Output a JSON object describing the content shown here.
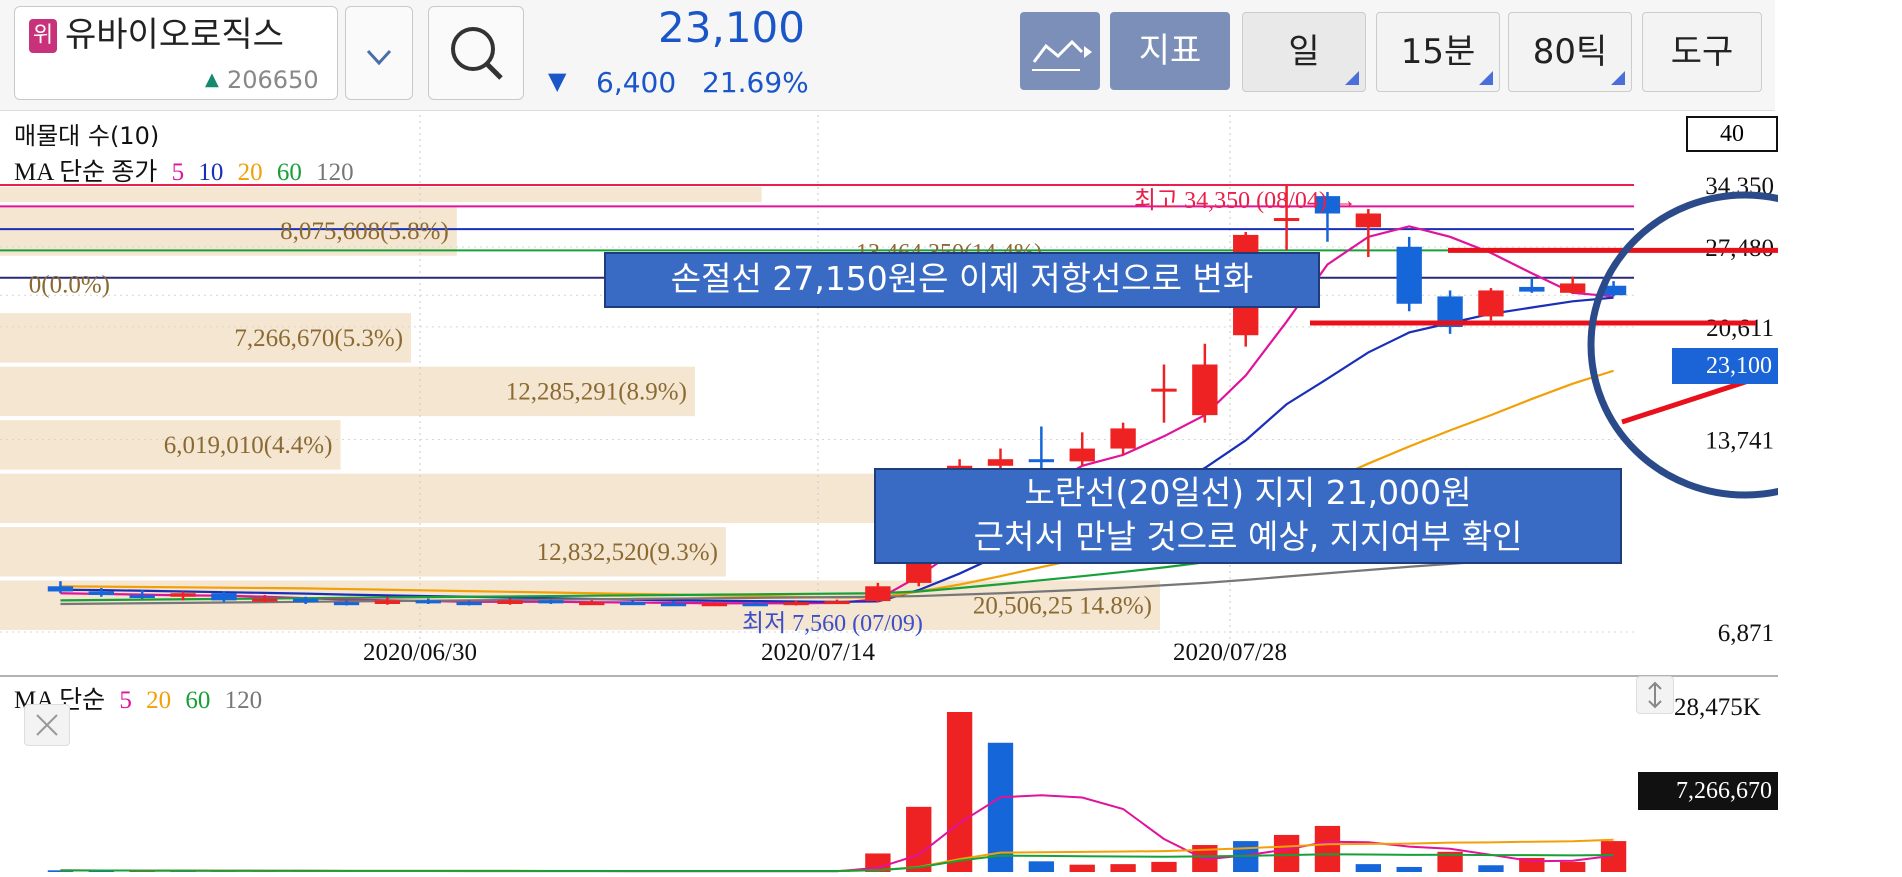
{
  "header": {
    "stock_icon_char": "위",
    "stock_name": "유바이오로직스",
    "stock_code": "206650",
    "price": "23,100",
    "change_arrow": "▼",
    "change": "6,400",
    "change_pct": "21.69%",
    "buttons": {
      "indicator": "지표",
      "period_day": "일",
      "period_15min": "15분",
      "period_80tick": "80틱",
      "tools": "도구"
    },
    "colors": {
      "down": "#1a56c8",
      "toggle_bg": "#7b8fb8"
    }
  },
  "price_panel": {
    "volume_profile_label": "매물대 수(10)",
    "ma_label": "MA 단순 종가",
    "ma_periods": [
      {
        "label": "5",
        "color": "#e0139a"
      },
      {
        "label": "10",
        "color": "#1a2fb8"
      },
      {
        "label": "20",
        "color": "#f2a007"
      },
      {
        "label": "60",
        "color": "#18a038"
      },
      {
        "label": "120",
        "color": "#777777"
      }
    ],
    "bins_box_value": "40",
    "high_annotation": "최고 34,350 (08/04) →",
    "low_annotation": "최저 7,560 (07/09)",
    "partial_label": "13,464,350(14.4%)",
    "volume_profile_labels": [
      "8,075,608(5.8%)",
      "0(0.0%)",
      "7,266,670(5.3%)",
      "12,285,291(8.9%)",
      "6,019,010(4.4%)",
      "12,832,520(9.3%)",
      "20,506,25  14.8%)"
    ],
    "y_axis_labels": [
      "34,350",
      "27,480",
      "23,100",
      "20,611",
      "13,741",
      "6,871"
    ],
    "x_axis_labels": [
      "2020/06/30",
      "2020/07/14",
      "2020/07/28"
    ]
  },
  "annotations": {
    "box1": "손절선 27,150원은 이제 저항선으로 변화",
    "box2_line1": "노란선(20일선) 지지 21,000원",
    "box2_line2": "근처서 만날 것으로 예상, 지지여부 확인"
  },
  "volume_panel": {
    "ma_label": "MA 단순",
    "ma_periods": [
      {
        "label": "5",
        "color": "#e0139a"
      },
      {
        "label": "20",
        "color": "#f2a007"
      },
      {
        "label": "60",
        "color": "#18a038"
      },
      {
        "label": "120",
        "color": "#777777"
      }
    ],
    "y_max_label": "28,475K",
    "y_current_label": "7,266,670"
  },
  "chart_data": {
    "type": "candlestick",
    "y_scale": "log",
    "ylim": [
      6871,
      34350
    ],
    "candles": [
      {
        "o": 8100,
        "h": 8250,
        "l": 7900,
        "c": 7950
      },
      {
        "o": 7950,
        "h": 8050,
        "l": 7800,
        "c": 7850
      },
      {
        "o": 7850,
        "h": 8000,
        "l": 7750,
        "c": 7800
      },
      {
        "o": 7800,
        "h": 7950,
        "l": 7700,
        "c": 7900
      },
      {
        "o": 7900,
        "h": 7950,
        "l": 7650,
        "c": 7700
      },
      {
        "o": 7700,
        "h": 7850,
        "l": 7650,
        "c": 7750
      },
      {
        "o": 7750,
        "h": 7800,
        "l": 7600,
        "c": 7650
      },
      {
        "o": 7650,
        "h": 7700,
        "l": 7560,
        "c": 7600
      },
      {
        "o": 7600,
        "h": 7800,
        "l": 7580,
        "c": 7700
      },
      {
        "o": 7700,
        "h": 7750,
        "l": 7600,
        "c": 7650
      },
      {
        "o": 7650,
        "h": 7700,
        "l": 7560,
        "c": 7600
      },
      {
        "o": 7600,
        "h": 7750,
        "l": 7580,
        "c": 7700
      },
      {
        "o": 7700,
        "h": 7720,
        "l": 7600,
        "c": 7620
      },
      {
        "o": 7620,
        "h": 7700,
        "l": 7580,
        "c": 7650
      },
      {
        "o": 7650,
        "h": 7700,
        "l": 7600,
        "c": 7620
      },
      {
        "o": 7620,
        "h": 7680,
        "l": 7560,
        "c": 7600
      },
      {
        "o": 7600,
        "h": 7650,
        "l": 7570,
        "c": 7620
      },
      {
        "o": 7620,
        "h": 7660,
        "l": 7580,
        "c": 7600
      },
      {
        "o": 7600,
        "h": 7700,
        "l": 7560,
        "c": 7650
      },
      {
        "o": 7650,
        "h": 7720,
        "l": 7600,
        "c": 7680
      },
      {
        "o": 7680,
        "h": 8200,
        "l": 7650,
        "c": 8100
      },
      {
        "o": 8200,
        "h": 11500,
        "l": 8100,
        "c": 11200
      },
      {
        "o": 11500,
        "h": 12800,
        "l": 10200,
        "c": 12500
      },
      {
        "o": 12500,
        "h": 13300,
        "l": 11500,
        "c": 12800
      },
      {
        "o": 12800,
        "h": 14400,
        "l": 12100,
        "c": 12700
      },
      {
        "o": 12700,
        "h": 14100,
        "l": 12500,
        "c": 13300
      },
      {
        "o": 13300,
        "h": 14600,
        "l": 13000,
        "c": 14300
      },
      {
        "o": 16500,
        "h": 18000,
        "l": 14600,
        "c": 16500
      },
      {
        "o": 15000,
        "h": 19400,
        "l": 14600,
        "c": 18000
      },
      {
        "o": 20000,
        "h": 29000,
        "l": 19200,
        "c": 28700
      },
      {
        "o": 30500,
        "h": 34350,
        "l": 27200,
        "c": 30500
      },
      {
        "o": 33000,
        "h": 33500,
        "l": 28000,
        "c": 31000
      },
      {
        "o": 29500,
        "h": 31500,
        "l": 26500,
        "c": 31000
      },
      {
        "o": 27500,
        "h": 28500,
        "l": 21800,
        "c": 22400
      },
      {
        "o": 23000,
        "h": 23500,
        "l": 20100,
        "c": 20600
      },
      {
        "o": 21400,
        "h": 23700,
        "l": 21100,
        "c": 23500
      },
      {
        "o": 23800,
        "h": 24600,
        "l": 23300,
        "c": 23400
      },
      {
        "o": 23300,
        "h": 24700,
        "l": 23200,
        "c": 24100
      },
      {
        "o": 23900,
        "h": 24300,
        "l": 23000,
        "c": 23100
      }
    ],
    "volume": {
      "ylim": [
        0,
        28475000
      ],
      "bars": [
        {
          "v": 300000,
          "up": false
        },
        {
          "v": 250000,
          "up": false
        },
        {
          "v": 200000,
          "up": true
        },
        {
          "v": 220000,
          "up": false
        },
        {
          "v": 180000,
          "up": false
        },
        {
          "v": 200000,
          "up": true
        },
        {
          "v": 160000,
          "up": false
        },
        {
          "v": 150000,
          "up": false
        },
        {
          "v": 170000,
          "up": true
        },
        {
          "v": 160000,
          "up": false
        },
        {
          "v": 150000,
          "up": false
        },
        {
          "v": 150000,
          "up": true
        },
        {
          "v": 140000,
          "up": false
        },
        {
          "v": 140000,
          "up": true
        },
        {
          "v": 130000,
          "up": false
        },
        {
          "v": 130000,
          "up": false
        },
        {
          "v": 120000,
          "up": true
        },
        {
          "v": 120000,
          "up": false
        },
        {
          "v": 130000,
          "up": true
        },
        {
          "v": 150000,
          "up": true
        },
        {
          "v": 3300000,
          "up": true
        },
        {
          "v": 11600000,
          "up": true
        },
        {
          "v": 28475000,
          "up": true
        },
        {
          "v": 23000000,
          "up": false
        },
        {
          "v": 1900000,
          "up": false
        },
        {
          "v": 1300000,
          "up": true
        },
        {
          "v": 1400000,
          "up": true
        },
        {
          "v": 1800000,
          "up": true
        },
        {
          "v": 4800000,
          "up": true
        },
        {
          "v": 5500000,
          "up": false
        },
        {
          "v": 6600000,
          "up": true
        },
        {
          "v": 8200000,
          "up": true
        },
        {
          "v": 1400000,
          "up": false
        },
        {
          "v": 900000,
          "up": false
        },
        {
          "v": 3600000,
          "up": true
        },
        {
          "v": 1200000,
          "up": false
        },
        {
          "v": 2500000,
          "up": true
        },
        {
          "v": 1800000,
          "up": true
        },
        {
          "v": 5500000,
          "up": true
        }
      ]
    },
    "ma_series": [
      {
        "name": "5",
        "color": "#e0139a",
        "values": [
          7900,
          7880,
          7860,
          7840,
          7830,
          7800,
          7760,
          7720,
          7700,
          7680,
          7660,
          7660,
          7660,
          7650,
          7640,
          7630,
          7620,
          7620,
          7620,
          7630,
          7730,
          8400,
          9300,
          10500,
          11500,
          12500,
          13000,
          13900,
          15000,
          17300,
          21000,
          25800,
          28500,
          29600,
          28500,
          26900,
          25000,
          23300,
          23000
        ]
      },
      {
        "name": "10",
        "color": "#1a2fb8",
        "values": [
          8000,
          7990,
          7970,
          7950,
          7930,
          7910,
          7890,
          7860,
          7840,
          7820,
          7800,
          7780,
          7760,
          7740,
          7720,
          7700,
          7690,
          7680,
          7670,
          7660,
          7670,
          7990,
          8480,
          9080,
          9700,
          10300,
          10800,
          11500,
          12400,
          13700,
          15600,
          17100,
          18800,
          20200,
          20900,
          21600,
          22100,
          22600,
          22900
        ]
      },
      {
        "name": "20",
        "color": "#f2a007",
        "values": [
          8100,
          8090,
          8080,
          8070,
          8060,
          8050,
          8040,
          8020,
          8000,
          7980,
          7960,
          7940,
          7920,
          7900,
          7880,
          7860,
          7840,
          7820,
          7800,
          7780,
          7780,
          7950,
          8150,
          8400,
          8680,
          8960,
          9240,
          9560,
          9940,
          10460,
          11100,
          11800,
          12600,
          13400,
          14200,
          15000,
          15900,
          16800,
          17600
        ]
      },
      {
        "name": "60",
        "color": "#18a038",
        "values": [
          7700,
          7710,
          7720,
          7730,
          7740,
          7750,
          7760,
          7770,
          7780,
          7790,
          7800,
          7810,
          7820,
          7830,
          7840,
          7850,
          7860,
          7870,
          7880,
          7890,
          7900,
          7950,
          8050,
          8160,
          8280,
          8400,
          8530,
          8670,
          8830,
          9030,
          9270,
          9540,
          9820,
          10100,
          10360,
          10620,
          10900,
          11150,
          11400
        ]
      },
      {
        "name": "120",
        "color": "#777777",
        "values": [
          7600,
          7610,
          7620,
          7630,
          7640,
          7650,
          7660,
          7670,
          7680,
          7690,
          7700,
          7710,
          7720,
          7730,
          7740,
          7750,
          7760,
          7770,
          7780,
          7790,
          7800,
          7820,
          7860,
          7900,
          7950,
          8000,
          8060,
          8130,
          8200,
          8290,
          8390,
          8490,
          8590,
          8690,
          8780,
          8870,
          8960,
          9050,
          9140
        ]
      }
    ],
    "horizontal_lines": [
      {
        "value": 34350,
        "color": "#e8204a"
      },
      {
        "value": 31800,
        "color": "#e0139a"
      },
      {
        "value": 29300,
        "color": "#1a2fb8"
      },
      {
        "value": 27150,
        "color": "#18a038"
      },
      {
        "value": 24600,
        "color": "#2a2a78"
      }
    ],
    "volume_profile": [
      {
        "price_lo": 6871,
        "price_hi": 8330,
        "volume": 20506250,
        "label_index": 6
      },
      {
        "price_lo": 8330,
        "price_hi": 10100,
        "volume": 12832520,
        "label_index": 5
      },
      {
        "price_lo": 10100,
        "price_hi": 12240,
        "volume": 16000000,
        "label_index": -1
      },
      {
        "price_lo": 12240,
        "price_hi": 14840,
        "volume": 6019010,
        "label_index": 4
      },
      {
        "price_lo": 14840,
        "price_hi": 17990,
        "volume": 12285291,
        "label_index": 3
      },
      {
        "price_lo": 17990,
        "price_hi": 21810,
        "volume": 7266670,
        "label_index": 2
      },
      {
        "price_lo": 21810,
        "price_hi": 26440,
        "volume": 0,
        "label_index": 1
      },
      {
        "price_lo": 26440,
        "price_hi": 32060,
        "volume": 8075608,
        "label_index": 0
      },
      {
        "price_lo": 32060,
        "price_hi": 34350,
        "volume": 13464350,
        "label_index": -1
      }
    ],
    "markup_lines": [
      {
        "type": "horizontal",
        "value": 27150,
        "color": "#e8101a"
      },
      {
        "type": "horizontal",
        "value": 20900,
        "color": "#e8101a"
      }
    ]
  }
}
